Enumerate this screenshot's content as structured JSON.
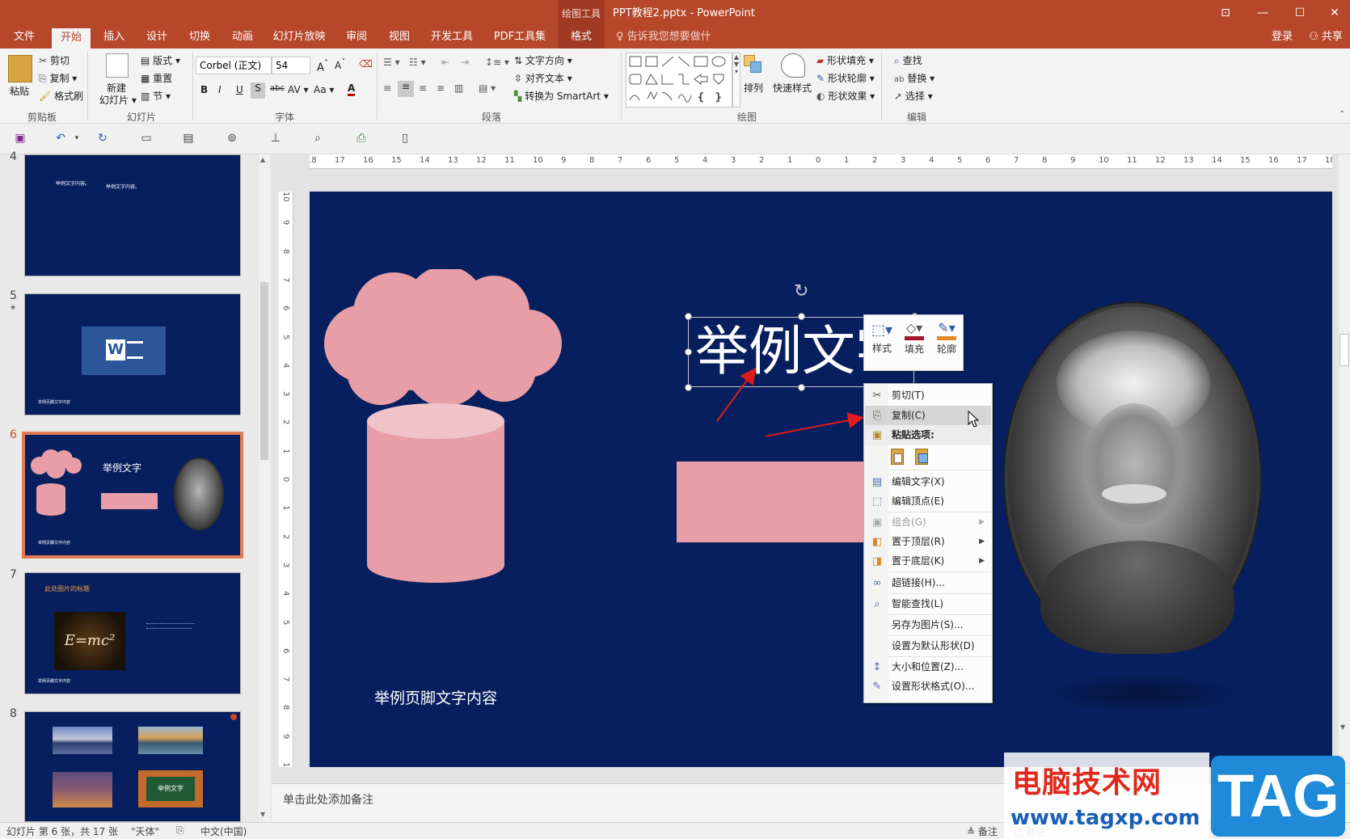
{
  "titlebar": {
    "context_tab": "绘图工具",
    "title": "PPT教程2.pptx - PowerPoint"
  },
  "tabs": [
    "文件",
    "开始",
    "插入",
    "设计",
    "切换",
    "动画",
    "幻灯片放映",
    "审阅",
    "视图",
    "开发工具",
    "PDF工具集",
    "格式"
  ],
  "tell_me": "告诉我您想要做什么...",
  "login": "登录",
  "share": "共享",
  "ribbon": {
    "clipboard": {
      "paste": "粘贴",
      "cut": "剪切",
      "copy": "复制",
      "format_painter": "格式刷",
      "group": "剪贴板"
    },
    "slides": {
      "new_slide_1": "新建",
      "new_slide_2": "幻灯片",
      "layout": "版式",
      "reset": "重置",
      "section": "节",
      "group": "幻灯片"
    },
    "font": {
      "name": "Corbel (正文)",
      "size": "54",
      "group": "字体"
    },
    "paragraph": {
      "text_direction": "文字方向",
      "align_text": "对齐文本",
      "smartart": "转换为 SmartArt",
      "group": "段落"
    },
    "drawing": {
      "arrange": "排列",
      "quick_styles": "快速样式",
      "shape_fill": "形状填充",
      "shape_outline": "形状轮廓",
      "shape_effects": "形状效果",
      "group": "绘图"
    },
    "editing": {
      "find": "查找",
      "replace": "替换",
      "select": "选择",
      "group": "编辑"
    }
  },
  "ruler_h": [
    "18",
    "17",
    "16",
    "15",
    "14",
    "13",
    "12",
    "11",
    "10",
    "9",
    "8",
    "7",
    "6",
    "5",
    "4",
    "3",
    "2",
    "1",
    "0",
    "1",
    "2",
    "3",
    "4",
    "5",
    "6",
    "7",
    "8",
    "9",
    "10",
    "11",
    "12",
    "13",
    "14",
    "15",
    "16",
    "17",
    "18"
  ],
  "ruler_v": [
    "10",
    "9",
    "8",
    "7",
    "6",
    "5",
    "4",
    "3",
    "2",
    "1",
    "0",
    "1",
    "2",
    "3",
    "4",
    "5",
    "6",
    "7",
    "8",
    "9",
    "10"
  ],
  "thumbnails": {
    "n4": "4",
    "n5": "5",
    "n6": "6",
    "n7": "7",
    "n8": "8",
    "t4_text1": "举例文字内容。",
    "t4_text2": "举例文字内容。",
    "footer": "举例页脚文字内容",
    "t6_title": "举例文字",
    "t7_title": "此处图片的标题",
    "t7_formula": "E=mc²",
    "t8_label": "举例文字",
    "star": "★"
  },
  "slide": {
    "title_text": "举例文字",
    "footer_text": "举例页脚文字内容"
  },
  "mini_toolbar": {
    "style": "样式",
    "fill": "填充",
    "outline": "轮廓"
  },
  "context_menu": [
    {
      "label": "剪切(T)",
      "icon": "cut-icon",
      "glyph": "✂"
    },
    {
      "label": "复制(C)",
      "icon": "copy-icon",
      "glyph": "⎘"
    },
    {
      "label": "粘贴选项:",
      "icon": "paste-icon",
      "glyph": "📋"
    },
    {
      "label": "编辑文字(X)",
      "icon": "edit-text-icon",
      "glyph": "▤"
    },
    {
      "label": "编辑顶点(E)",
      "icon": "edit-points-icon",
      "glyph": "⬚"
    },
    {
      "label": "组合(G)",
      "icon": "group-icon",
      "glyph": "▣"
    },
    {
      "label": "置于顶层(R)",
      "icon": "bring-front-icon",
      "glyph": "◧"
    },
    {
      "label": "置于底层(K)",
      "icon": "send-back-icon",
      "glyph": "◨"
    },
    {
      "label": "超链接(H)...",
      "icon": "link-icon",
      "glyph": "∞"
    },
    {
      "label": "智能查找(L)",
      "icon": "smart-lookup-icon",
      "glyph": "⌕"
    },
    {
      "label": "另存为图片(S)...",
      "icon": "",
      "glyph": ""
    },
    {
      "label": "设置为默认形状(D)",
      "icon": "",
      "glyph": ""
    },
    {
      "label": "大小和位置(Z)...",
      "icon": "size-icon",
      "glyph": "↕"
    },
    {
      "label": "设置形状格式(O)...",
      "icon": "format-shape-icon",
      "glyph": "✎"
    }
  ],
  "notes_placeholder": "单击此处添加备注",
  "status": {
    "slide_info": "幻灯片 第 6 张，共 17 张",
    "theme": "\"天体\"",
    "lang": "中文(中国)",
    "notes": "备注",
    "comments": "批注"
  },
  "watermark": {
    "site_name": "电脑技术网",
    "url": "www.tagxp.com",
    "tag": "TAG"
  },
  "colors": {
    "accent": "#b7472a",
    "slide_bg": "#071f5e",
    "shape_pink": "#e79ea6",
    "arrow_red": "#e01b1b"
  }
}
